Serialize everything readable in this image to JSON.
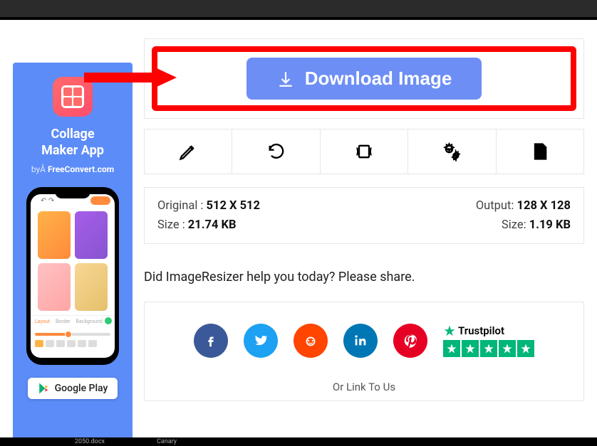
{
  "sidebar": {
    "title_line1": "Collage",
    "title_line2": "Maker App",
    "by_prefix": "byÂ ",
    "by_brand": "FreeConvert.com",
    "store_label": "Google Play"
  },
  "download": {
    "button_label": "Download Image"
  },
  "toolbar": {
    "items": [
      {
        "name": "edit-icon"
      },
      {
        "name": "undo-icon"
      },
      {
        "name": "compress-icon"
      },
      {
        "name": "settings-icon"
      },
      {
        "name": "pdf-icon"
      }
    ]
  },
  "info": {
    "original_label": "Original : ",
    "original_value": "512 X 512",
    "size_label": "Size : ",
    "size_value": "21.74 KB",
    "output_label": "Output: ",
    "output_value": "128 X 128",
    "outsize_label": "Size: ",
    "outsize_value": "1.19 KB"
  },
  "share": {
    "question": "Did ImageResizer help you today? Please share.",
    "trustpilot_label": "Trustpilot",
    "linkto_label": "Or Link To Us"
  },
  "taskbar": {
    "item1": "2050.docx",
    "item2": "Canary"
  }
}
